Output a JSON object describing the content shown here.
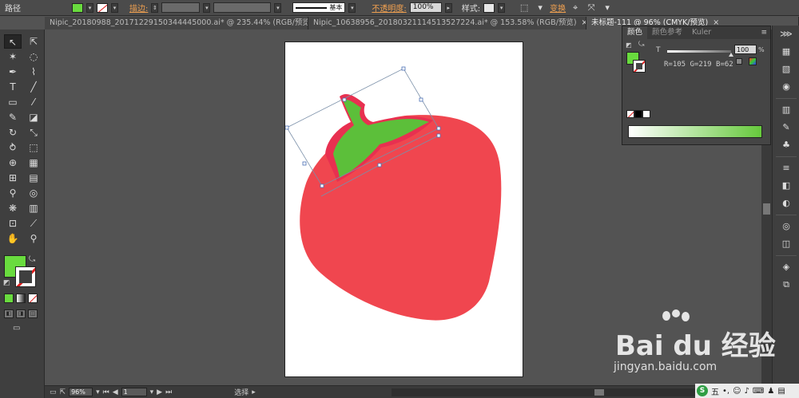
{
  "control_bar": {
    "object_type": "路径",
    "fill_color": "#69db3e",
    "stroke_label": "描边:",
    "stroke_profile": "基本",
    "opacity_label": "不透明度:",
    "opacity_value": "100%",
    "style_label": "样式:",
    "transform_label": "变换"
  },
  "tabs": [
    {
      "label": "Nipic_20180988_20171229150344445000.ai* @ 235.44% (RGB/预览)",
      "active": false
    },
    {
      "label": "Nipic_10638956_20180321114513527224.ai* @ 153.58% (RGB/预览)",
      "active": false
    },
    {
      "label": "未标题-111 @ 96% (CMYK/预览)",
      "active": true
    }
  ],
  "tools": [
    {
      "name": "selection-tool",
      "icon": "↖",
      "active": true
    },
    {
      "name": "direct-selection-tool",
      "icon": "⇱",
      "active": false
    },
    {
      "name": "magic-wand-tool",
      "icon": "✶",
      "active": false
    },
    {
      "name": "lasso-tool",
      "icon": "◌",
      "active": false
    },
    {
      "name": "pen-tool",
      "icon": "✒",
      "active": false
    },
    {
      "name": "curvature-tool",
      "icon": "⌇",
      "active": false
    },
    {
      "name": "type-tool",
      "icon": "T",
      "active": false
    },
    {
      "name": "line-tool",
      "icon": "╱",
      "active": false
    },
    {
      "name": "rectangle-tool",
      "icon": "▭",
      "active": false
    },
    {
      "name": "paintbrush-tool",
      "icon": "⁄",
      "active": false
    },
    {
      "name": "pencil-tool",
      "icon": "✎",
      "active": false
    },
    {
      "name": "eraser-tool",
      "icon": "◪",
      "active": false
    },
    {
      "name": "rotate-tool",
      "icon": "↻",
      "active": false
    },
    {
      "name": "scale-tool",
      "icon": "⤡",
      "active": false
    },
    {
      "name": "warp-tool",
      "icon": "⥁",
      "active": false
    },
    {
      "name": "free-transform-tool",
      "icon": "⬚",
      "active": false
    },
    {
      "name": "shape-builder-tool",
      "icon": "⊕",
      "active": false
    },
    {
      "name": "perspective-grid-tool",
      "icon": "▦",
      "active": false
    },
    {
      "name": "mesh-tool",
      "icon": "⊞",
      "active": false
    },
    {
      "name": "gradient-tool",
      "icon": "▤",
      "active": false
    },
    {
      "name": "eyedropper-tool",
      "icon": "⚲",
      "active": false
    },
    {
      "name": "blend-tool",
      "icon": "◎",
      "active": false
    },
    {
      "name": "symbol-sprayer-tool",
      "icon": "❋",
      "active": false
    },
    {
      "name": "column-graph-tool",
      "icon": "▥",
      "active": false
    },
    {
      "name": "artboard-tool",
      "icon": "⊡",
      "active": false
    },
    {
      "name": "slice-tool",
      "icon": "⟋",
      "active": false
    },
    {
      "name": "hand-tool",
      "icon": "✋",
      "active": false
    },
    {
      "name": "zoom-tool",
      "icon": "⚲",
      "active": false
    }
  ],
  "tool_colors": {
    "fill": "#69db3e",
    "stroke": "none"
  },
  "color_panel": {
    "tabs": [
      {
        "label": "颜色",
        "active": true
      },
      {
        "label": "颜色参考",
        "active": false
      },
      {
        "label": "Kuler",
        "active": false
      }
    ],
    "tint_label": "T",
    "tint_value": "100",
    "tint_unit": "%",
    "rgb_readout": "R=105  G=219  B=62",
    "spectrum_end": "#66c93c"
  },
  "status_bar": {
    "zoom": "96%",
    "page": "1",
    "tool_name": "选择"
  },
  "watermark": {
    "logo": "Bai du 经验",
    "url": "jingyan.baidu.com"
  },
  "ime": {
    "mode": "五"
  },
  "artwork": {
    "strawberry_color": "#f0464f",
    "leaves_color": "#5cbf3a",
    "outline_color": "#e83050"
  }
}
